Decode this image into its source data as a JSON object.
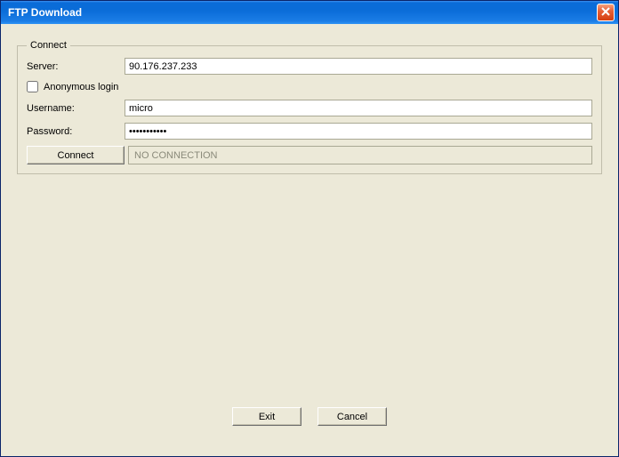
{
  "window": {
    "title": "FTP Download"
  },
  "group": {
    "legend": "Connect"
  },
  "labels": {
    "server": "Server:",
    "anonymous": "Anonymous login",
    "username": "Username:",
    "password": "Password:"
  },
  "values": {
    "server": "90.176.237.233",
    "username": "micro",
    "password": "xxxxxxxxxxx"
  },
  "buttons": {
    "connect": "Connect",
    "exit": "Exit",
    "cancel": "Cancel"
  },
  "status": "NO CONNECTION"
}
